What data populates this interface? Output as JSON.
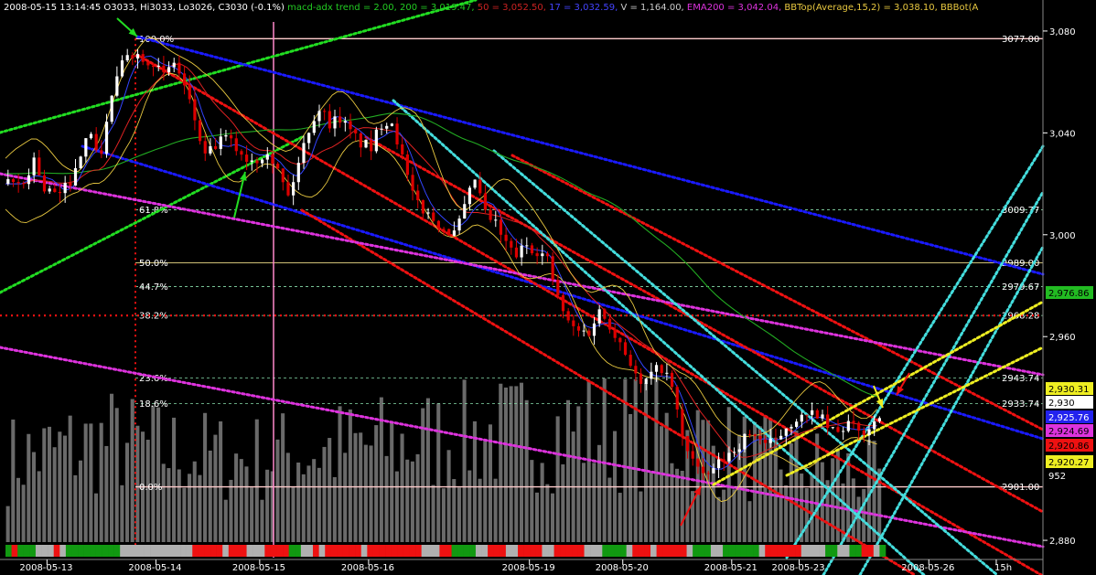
{
  "header": {
    "parts": [
      {
        "text": "2008-05-15 13:14:45 O3033, Hi3033, Lo3026, C3030 (-0.1%)",
        "color": "#ffffff"
      },
      {
        "text": "macd-adx trend = 2.00,",
        "color": "#22cc22"
      },
      {
        "text": "200 = 3,019.47,",
        "color": "#22cc22"
      },
      {
        "text": "50 = 3,052.50,",
        "color": "#cc2222"
      },
      {
        "text": "17 = 3,032.59,",
        "color": "#4444ff"
      },
      {
        "text": "V = 1,164.00,",
        "color": "#cccccc"
      },
      {
        "text": "EMA200 = 3,042.04,",
        "color": "#dd33dd"
      },
      {
        "text": "BBTop(Average,15,2) = 3,038.10, BBBot(A",
        "color": "#e8c840"
      }
    ]
  },
  "colors": {
    "background": "#000000",
    "candle_up": "#ffffff",
    "candle_down": "#dd0000",
    "blue_channel": "#1a1aff",
    "red_channel": "#ee1111",
    "magenta_channel": "#dd33dd",
    "cyan_channel": "#44dddd",
    "yellow_channel": "#eeee22",
    "green_trend": "#22dd22",
    "fib_line": "#ffffff",
    "volume": "#6a6a6a",
    "ma200": "#22aa22",
    "bollinger": "#e8c840",
    "ma17": "#3344ff",
    "ma50": "#dd2222"
  },
  "chart_data": {
    "type": "candlestick",
    "title": "",
    "ylim": [
      2875,
      3085
    ],
    "x_tick_labels": [
      "2008-05-13",
      "2008-05-14",
      "2008-05-15",
      "2008-05-16",
      "2008-05-19",
      "2008-05-20",
      "2008-05-21",
      "2008-05-23",
      "2008-05-26",
      "15h"
    ],
    "x_tick_bar_index": [
      8,
      29,
      49,
      70,
      101,
      119,
      140,
      153,
      178,
      191
    ],
    "y_ticks": [
      {
        "value": 3080,
        "label": "3,080"
      },
      {
        "value": 3040,
        "label": "3,040"
      },
      {
        "value": 3000,
        "label": "3,000"
      },
      {
        "value": 2960,
        "label": "2,960"
      },
      {
        "value": 2880,
        "label": "2,880"
      }
    ],
    "fib_levels": [
      {
        "pct": "100.0%",
        "price": 3077.0,
        "label": "3077.00"
      },
      {
        "pct": "61.8%",
        "price": 3009.77,
        "label": "3009.77"
      },
      {
        "pct": "50.0%",
        "price": 2989.0,
        "label": "2989.00"
      },
      {
        "pct": "44.7%",
        "price": 2979.67,
        "label": "2979.67"
      },
      {
        "pct": "38.2%",
        "price": 2968.28,
        "label": "2968.28"
      },
      {
        "pct": "23.6%",
        "price": 2943.74,
        "label": "2943.74"
      },
      {
        "pct": "18.6%",
        "price": 2933.74,
        "label": "2933.74"
      },
      {
        "pct": "0.0%",
        "price": 2901.0,
        "label": "2901.00"
      }
    ],
    "price_tags": [
      {
        "value": 2976.86,
        "label": "2,976.86",
        "bg": "#22bb22",
        "fg": "#000000"
      },
      {
        "value": 2930.31,
        "label": "2,930.31",
        "bg": "#eeee22",
        "fg": "#000000"
      },
      {
        "value": 2930.0,
        "label": "2,930",
        "bg": "#ffffff",
        "fg": "#000000"
      },
      {
        "value": 2925.76,
        "label": "2,925.76",
        "bg": "#2222ee",
        "fg": "#ffffff"
      },
      {
        "value": 2924.69,
        "label": "2,924.69",
        "bg": "#dd33dd",
        "fg": "#000000"
      },
      {
        "value": 2922.36,
        "label": "2,920.86",
        "bg": "#ee1111",
        "fg": "#000000"
      },
      {
        "value": 2920.27,
        "label": "2,920.27",
        "bg": "#eeee22",
        "fg": "#000000"
      }
    ],
    "volume_last_label": "952",
    "price_series_keypoints": [
      [
        0,
        3020
      ],
      [
        3,
        3020
      ],
      [
        5,
        3030
      ],
      [
        7,
        3018
      ],
      [
        10,
        3015
      ],
      [
        13,
        3025
      ],
      [
        15,
        3040
      ],
      [
        18,
        3032
      ],
      [
        20,
        3055
      ],
      [
        23,
        3072
      ],
      [
        26,
        3070
      ],
      [
        28,
        3068
      ],
      [
        30,
        3062
      ],
      [
        32,
        3068
      ],
      [
        34,
        3058
      ],
      [
        36,
        3045
      ],
      [
        38,
        3030
      ],
      [
        40,
        3035
      ],
      [
        42,
        3038
      ],
      [
        44,
        3034
      ],
      [
        46,
        3030
      ],
      [
        48,
        3030
      ],
      [
        50,
        3034
      ],
      [
        52,
        3025
      ],
      [
        54,
        3015
      ],
      [
        56,
        3028
      ],
      [
        58,
        3042
      ],
      [
        60,
        3050
      ],
      [
        62,
        3044
      ],
      [
        64,
        3046
      ],
      [
        66,
        3040
      ],
      [
        68,
        3036
      ],
      [
        70,
        3034
      ],
      [
        72,
        3044
      ],
      [
        74,
        3045
      ],
      [
        76,
        3030
      ],
      [
        78,
        3015
      ],
      [
        80,
        3010
      ],
      [
        82,
        3006
      ],
      [
        84,
        3003
      ],
      [
        86,
        3000
      ],
      [
        88,
        3010
      ],
      [
        90,
        3022
      ],
      [
        92,
        3008
      ],
      [
        94,
        3004
      ],
      [
        96,
        2996
      ],
      [
        98,
        2992
      ],
      [
        100,
        2996
      ],
      [
        102,
        2994
      ],
      [
        104,
        2990
      ],
      [
        106,
        2975
      ],
      [
        108,
        2965
      ],
      [
        110,
        2962
      ],
      [
        112,
        2962
      ],
      [
        114,
        2970
      ],
      [
        116,
        2965
      ],
      [
        118,
        2958
      ],
      [
        120,
        2950
      ],
      [
        122,
        2940
      ],
      [
        124,
        2945
      ],
      [
        126,
        2948
      ],
      [
        128,
        2940
      ],
      [
        130,
        2920
      ],
      [
        132,
        2912
      ],
      [
        134,
        2904
      ],
      [
        136,
        2908
      ],
      [
        138,
        2912
      ],
      [
        140,
        2916
      ],
      [
        142,
        2920
      ],
      [
        144,
        2922
      ],
      [
        146,
        2918
      ],
      [
        148,
        2918
      ],
      [
        150,
        2925
      ],
      [
        152,
        2928
      ],
      [
        154,
        2928
      ],
      [
        156,
        2930
      ],
      [
        158,
        2924
      ],
      [
        160,
        2922
      ],
      [
        162,
        2926
      ],
      [
        164,
        2922
      ],
      [
        166,
        2924
      ],
      [
        168,
        2930
      ]
    ],
    "volume_profile": [
      [
        0,
        0.45
      ],
      [
        10,
        0.5
      ],
      [
        20,
        0.55
      ],
      [
        30,
        0.5
      ],
      [
        45,
        0.45
      ],
      [
        60,
        0.5
      ],
      [
        80,
        0.55
      ],
      [
        100,
        0.6
      ],
      [
        115,
        0.62
      ],
      [
        130,
        0.58
      ],
      [
        145,
        0.45
      ],
      [
        160,
        0.4
      ],
      [
        168,
        0.35
      ]
    ],
    "status_strip": [
      "g",
      "r",
      "g",
      "g",
      "g",
      "k",
      "k",
      "k",
      "r",
      "k",
      "g",
      "g",
      "g",
      "g",
      "g",
      "g",
      "g",
      "g",
      "g",
      "k",
      "k",
      "k",
      "k",
      "k",
      "k",
      "k",
      "k",
      "k",
      "k",
      "k",
      "k",
      "r",
      "r",
      "r",
      "r",
      "r",
      "k",
      "r",
      "r",
      "r",
      "k",
      "k",
      "k",
      "r",
      "r",
      "r",
      "r",
      "g",
      "g",
      "k",
      "k",
      "r",
      "k",
      "r",
      "r",
      "r",
      "r",
      "r",
      "r",
      "k",
      "r",
      "r",
      "r",
      "r",
      "r",
      "r",
      "r",
      "r",
      "r",
      "k",
      "k",
      "k",
      "r",
      "r",
      "g",
      "g",
      "g",
      "g",
      "k",
      "k",
      "r",
      "r",
      "r",
      "k",
      "k",
      "r",
      "r",
      "r",
      "r",
      "k",
      "k",
      "r",
      "r",
      "r",
      "r",
      "r",
      "k",
      "k",
      "k",
      "g",
      "g",
      "g",
      "g",
      "k",
      "r",
      "r",
      "r",
      "k",
      "r",
      "r",
      "r",
      "r",
      "r",
      "k",
      "g",
      "g",
      "g",
      "k",
      "k",
      "g",
      "g",
      "g",
      "g",
      "g",
      "g",
      "k",
      "r",
      "r",
      "r",
      "r",
      "r",
      "r",
      "k",
      "k",
      "k",
      "k",
      "g",
      "g",
      "k",
      "k",
      "g",
      "g",
      "r",
      "r",
      "k",
      "g"
    ]
  }
}
